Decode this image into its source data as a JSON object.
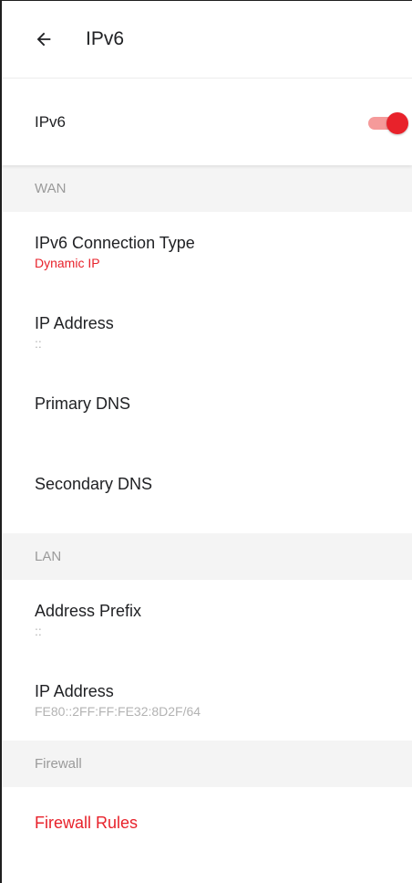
{
  "appbar": {
    "back_icon": "arrow-left-icon",
    "title": "IPv6"
  },
  "ipv6_toggle": {
    "label": "IPv6",
    "enabled": true
  },
  "sections": {
    "wan": {
      "header": "WAN",
      "connection_type": {
        "title": "IPv6 Connection Type",
        "value": "Dynamic IP"
      },
      "ip_address": {
        "title": "IP Address",
        "value": "::"
      },
      "primary_dns": {
        "title": "Primary DNS",
        "value": ""
      },
      "secondary_dns": {
        "title": "Secondary DNS",
        "value": ""
      }
    },
    "lan": {
      "header": "LAN",
      "address_prefix": {
        "title": "Address Prefix",
        "value": "::"
      },
      "ip_address": {
        "title": "IP Address",
        "value": "FE80::2FF:FF:FE32:8D2F/64"
      }
    },
    "firewall": {
      "header": "Firewall",
      "rules_label": "Firewall Rules"
    }
  },
  "colors": {
    "accent": "#e8222b",
    "accent_light": "#f59a9a",
    "section_bg": "#f4f4f4",
    "muted_text": "#9a9a9a"
  }
}
